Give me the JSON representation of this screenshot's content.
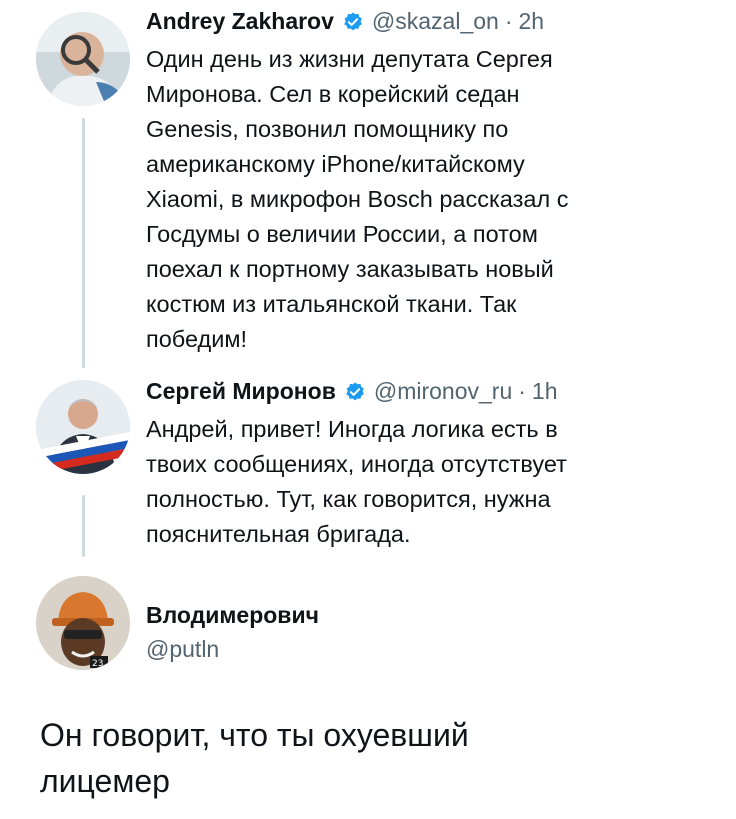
{
  "tweets": [
    {
      "name": "Andrey Zakharov",
      "handle": "@skazal_on",
      "separator": "·",
      "time": "2h",
      "text": "Один день из жизни депутата Сергея\nМиронова. Сел в корейский седан\nGenesis, позвонил помощнику по\nамериканскому iPhone/китайскому\nXiaomi, в микрофон Bosch рассказал с\nГосдумы о величии России, а потом\nпоехал к портному заказывать новый\nкостюм из итальянской ткани. Так\nпобедим!"
    },
    {
      "name": "Сергей Миронов",
      "handle": "@mironov_ru",
      "separator": "·",
      "time": "1h",
      "text": "Андрей, привет! Иногда логика есть в\nтвоих сообщениях, иногда отсутствует\nполностью. Тут, как говорится, нужна\nпояснительная бригада."
    }
  ],
  "profile": {
    "name": "Влодимерович",
    "handle": "@putln",
    "badge": "23"
  },
  "reply_text": "Он говорит, что ты охуевший\nлицемер",
  "colors": {
    "verified": "#1d9bf0",
    "thread_line": "#cfd9de",
    "secondary_text": "#536471"
  },
  "icons": {
    "verified": "verified-badge-icon"
  }
}
